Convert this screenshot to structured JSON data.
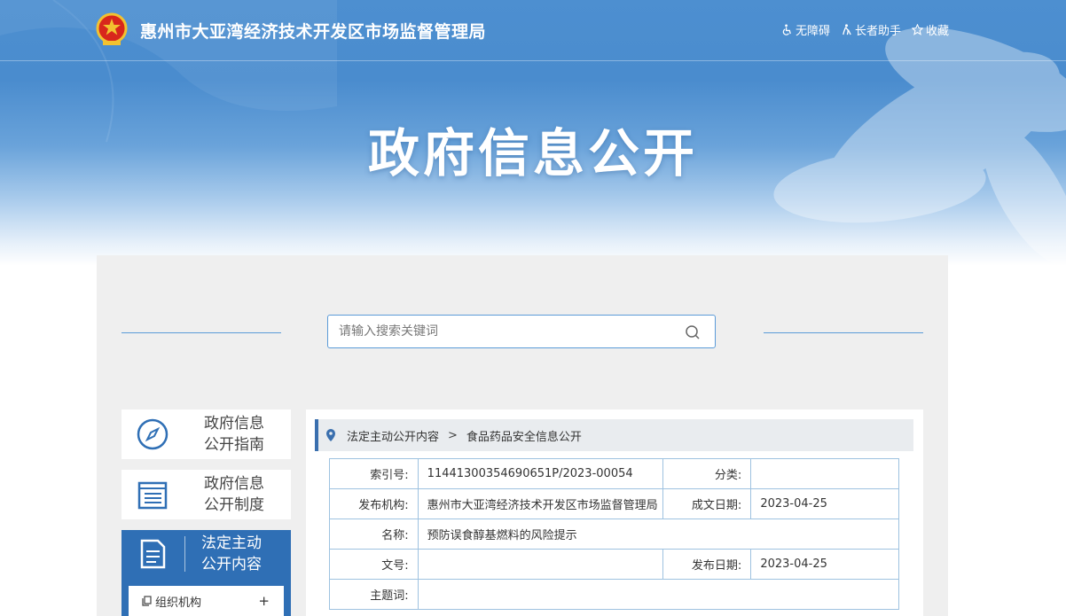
{
  "header": {
    "site_title": "惠州市大亚湾经济技术开发区市场监督管理局",
    "tools": [
      {
        "label": "无障碍",
        "icon": "wheelchair-icon"
      },
      {
        "label": "长者助手",
        "icon": "elder-icon"
      },
      {
        "label": "收藏",
        "icon": "star-icon"
      }
    ]
  },
  "hero": {
    "title": "政府信息公开"
  },
  "search": {
    "placeholder": "请输入搜索关键词"
  },
  "sidebar": {
    "items": [
      {
        "label_line1": "政府信息",
        "label_line2": "公开指南",
        "icon": "compass-icon"
      },
      {
        "label_line1": "政府信息",
        "label_line2": "公开制度",
        "icon": "list-icon"
      },
      {
        "label_line1": "法定主动",
        "label_line2": "公开内容",
        "icon": "document-icon",
        "active": true
      }
    ],
    "sub_items": [
      {
        "label": "组织机构",
        "expander": "+"
      }
    ]
  },
  "breadcrumb": {
    "items": [
      "法定主动公开内容",
      "食品药品安全信息公开"
    ],
    "separator": ">"
  },
  "details": {
    "index_label": "索引号:",
    "index_value": "11441300354690651P/2023-00054",
    "category_label": "分类:",
    "category_value": "",
    "publisher_label": "发布机构:",
    "publisher_value": "惠州市大亚湾经济技术开发区市场监督管理局",
    "created_label": "成文日期:",
    "created_value": "2023-04-25",
    "name_label": "名称:",
    "name_value": "预防误食醇基燃料的风险提示",
    "docno_label": "文号:",
    "docno_value": "",
    "pubdate_label": "发布日期:",
    "pubdate_value": "2023-04-25",
    "keywords_label": "主题词:",
    "keywords_value": ""
  },
  "colors": {
    "accent": "#2f6fb5",
    "banner": "#4a8cce",
    "line": "#5b9bd8",
    "panel": "#efefef"
  }
}
